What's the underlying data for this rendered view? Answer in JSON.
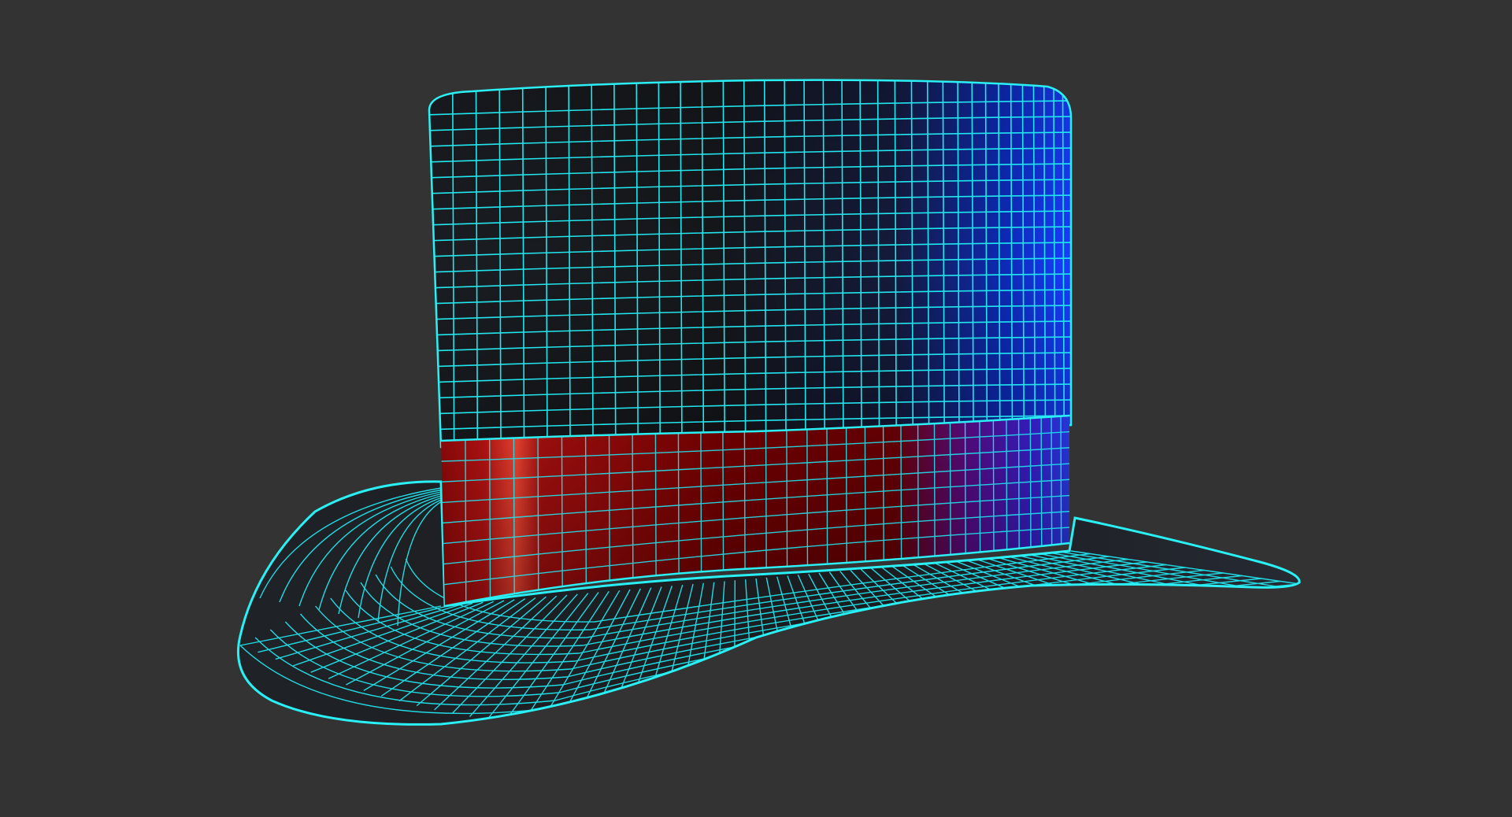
{
  "scene": {
    "subject": "top-hat-3d-wireframe-render",
    "colors": {
      "background": "#333333",
      "wireframe": "#22e5ee",
      "hat_body_dark": "#15171b",
      "hat_body_blue": "#0f2fd6",
      "band_red": "#8a0000",
      "band_highlight": "#ff3a2a",
      "band_purple": "#6a12b0",
      "brim_dark": "#1a1c20"
    }
  }
}
